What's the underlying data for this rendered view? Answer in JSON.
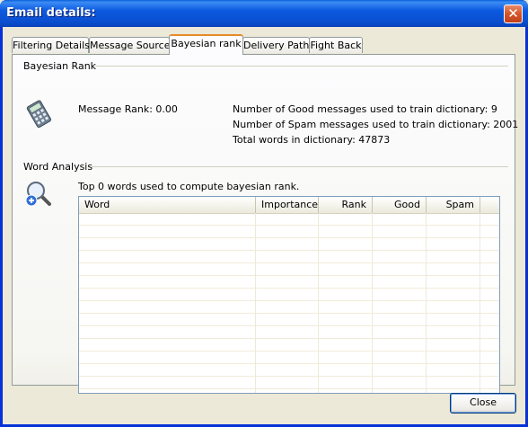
{
  "window": {
    "title": "Email details:",
    "close_glyph": "✕"
  },
  "tabs": [
    {
      "label": "Filtering Details"
    },
    {
      "label": "Message Source"
    },
    {
      "label": "Bayesian rank",
      "active": true
    },
    {
      "label": "Delivery Path"
    },
    {
      "label": "Fight Back"
    }
  ],
  "bayesian_rank": {
    "group_label": "Bayesian Rank",
    "icon": "calculator-icon",
    "message_rank": "Message Rank: 0.00",
    "good_messages": "Number of Good messages used to train dictionary: 9",
    "spam_messages": "Number of Spam messages used to train dictionary: 2001",
    "total_words": "Total words in dictionary: 47873"
  },
  "word_analysis": {
    "group_label": "Word Analysis",
    "icon": "magnifier-add-icon",
    "summary": "Top 0 words used to compute bayesian rank.",
    "columns": [
      "Word",
      "Importance",
      "Rank",
      "Good",
      "Spam"
    ],
    "rows": []
  },
  "footer": {
    "close_label": "Close"
  },
  "colors": {
    "titlebar": "#0a4fd0",
    "active_tab_accent": "#e68b2c",
    "window_bg": "#ece9d8"
  }
}
